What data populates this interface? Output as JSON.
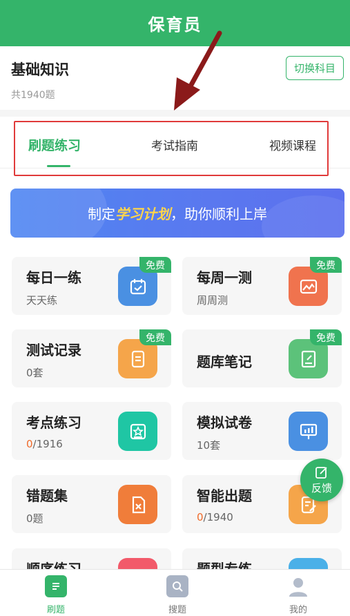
{
  "header": {
    "title": "保育员"
  },
  "subject": {
    "name": "基础知识",
    "count": "共1940题",
    "switch_label": "切换科目"
  },
  "tabs": [
    {
      "label": "刷题练习"
    },
    {
      "label": "考试指南"
    },
    {
      "label": "视频课程"
    }
  ],
  "banner": {
    "prefix": "制定",
    "highlight": "学习计划",
    "suffix": "，助你顺利上岸"
  },
  "cards": [
    {
      "title": "每日一练",
      "subtitle": "天天练",
      "badge": "免费",
      "icon": "calendar-check-icon",
      "color": "#4a90e2"
    },
    {
      "title": "每周一测",
      "subtitle": "周周测",
      "badge": "免费",
      "icon": "image-chart-icon",
      "color": "#f0734e"
    },
    {
      "title": "测试记录",
      "subtitle": "0套",
      "badge": "免费",
      "icon": "document-list-icon",
      "color": "#f5a54a"
    },
    {
      "title": "题库笔记",
      "subtitle": "",
      "badge": "免费",
      "icon": "notebook-edit-icon",
      "color": "#5cc27a"
    },
    {
      "title": "考点练习",
      "subtitle_red": "0",
      "subtitle_rest": "/1916",
      "icon": "star-book-icon",
      "color": "#1fc6a4"
    },
    {
      "title": "模拟试卷",
      "subtitle": "10套",
      "icon": "presentation-board-icon",
      "color": "#4a90e2"
    },
    {
      "title": "错题集",
      "subtitle": "0题",
      "icon": "wrong-file-icon",
      "color": "#f07d3a"
    },
    {
      "title": "智能出题",
      "subtitle_red": "0",
      "subtitle_rest": "/1940",
      "icon": "smart-edit-icon",
      "color": "#f5a54a"
    },
    {
      "title": "顺序练习",
      "subtitle": "",
      "icon": "sequence-icon",
      "color": "#f25a6a"
    },
    {
      "title": "题型专练",
      "subtitle": "",
      "icon": "type-practice-icon",
      "color": "#4ab0e8"
    }
  ],
  "feedback": {
    "label": "反馈"
  },
  "bottom_nav": [
    {
      "label": "刷题",
      "icon": "practice-icon"
    },
    {
      "label": "搜题",
      "icon": "search-icon"
    },
    {
      "label": "我的",
      "icon": "user-icon"
    }
  ],
  "colors": {
    "brand": "#34b46a",
    "highlight_box": "#e03a3a",
    "annotation_arrow": "#8b1a1a"
  }
}
